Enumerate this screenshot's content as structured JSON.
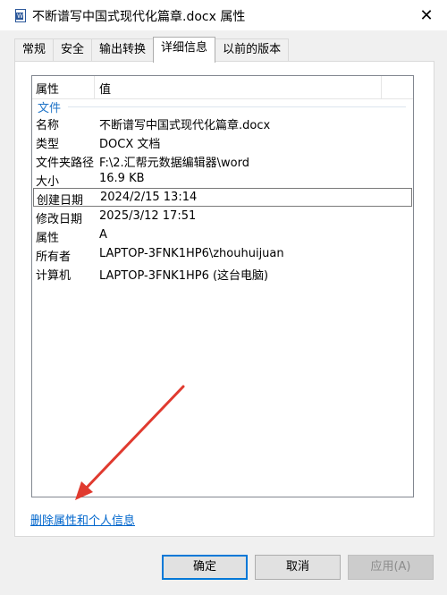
{
  "window": {
    "title": "不断谱写中国式现代化篇章.docx 属性",
    "icon": "word-doc-icon",
    "close_glyph": "✕"
  },
  "tabs": [
    {
      "label": "常规"
    },
    {
      "label": "安全"
    },
    {
      "label": "输出转换"
    },
    {
      "label": "详细信息",
      "active": true
    },
    {
      "label": "以前的版本"
    }
  ],
  "details": {
    "header": {
      "property": "属性",
      "value": "值"
    },
    "group": "文件",
    "rows": [
      {
        "key": "名称",
        "value": "不断谱写中国式现代化篇章.docx"
      },
      {
        "key": "类型",
        "value": "DOCX 文档"
      },
      {
        "key": "文件夹路径",
        "value": "F:\\2.汇帮元数据编辑器\\word"
      },
      {
        "key": "大小",
        "value": "16.9 KB"
      },
      {
        "key": "创建日期",
        "value": "2024/2/15 13:14",
        "selected": true
      },
      {
        "key": "修改日期",
        "value": "2025/3/12 17:51"
      },
      {
        "key": "属性",
        "value": "A"
      },
      {
        "key": "所有者",
        "value": "LAPTOP-3FNK1HP6\\zhouhuijuan"
      },
      {
        "key": "计算机",
        "value": "LAPTOP-3FNK1HP6 (这台电脑)"
      }
    ]
  },
  "remove_link": "删除属性和个人信息",
  "buttons": {
    "ok": "确定",
    "cancel": "取消",
    "apply": "应用(A)"
  },
  "colors": {
    "link": "#0066cc",
    "group": "#1e73c7",
    "arrow": "#e03a2f",
    "focus": "#0078d7"
  }
}
